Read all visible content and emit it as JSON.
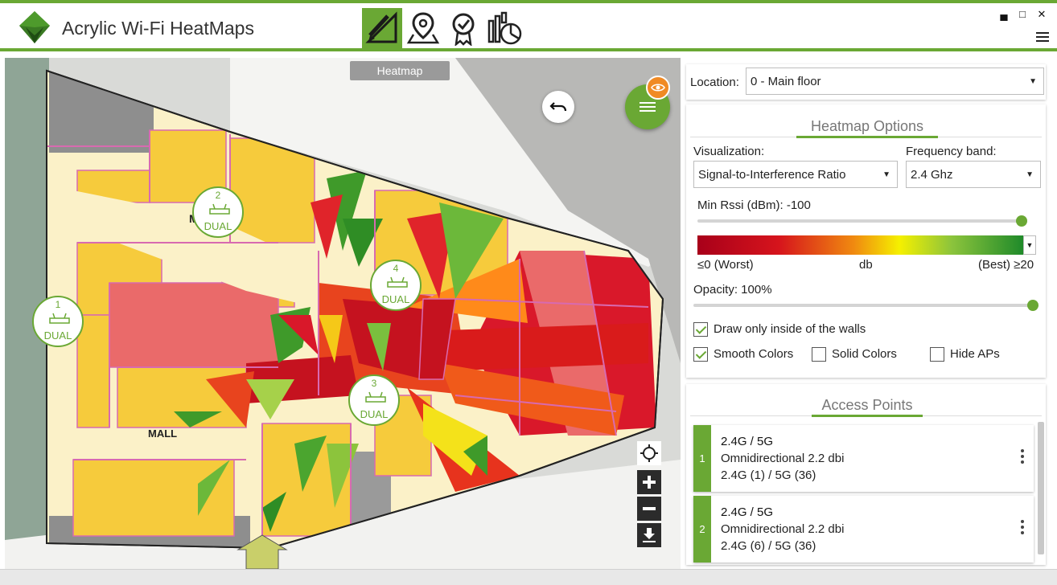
{
  "app": {
    "title": "Acrylic Wi-Fi HeatMaps",
    "accent_color": "#6aa834",
    "window_controls": [
      "minimize-icon",
      "maximize-icon",
      "close-icon"
    ],
    "toolbar": [
      "edit-plan-icon",
      "location-pin-icon",
      "certificate-icon",
      "reports-icon"
    ]
  },
  "map": {
    "tab_label": "Heatmap",
    "labels": [
      "MALL",
      "M"
    ],
    "access_points": [
      {
        "number": "1",
        "band": "DUAL"
      },
      {
        "number": "2",
        "band": "DUAL"
      },
      {
        "number": "3",
        "band": "DUAL"
      },
      {
        "number": "4",
        "band": "DUAL"
      }
    ]
  },
  "location": {
    "label": "Location:",
    "value": "0 - Main floor"
  },
  "heatmap_options": {
    "title": "Heatmap Options",
    "visualization_label": "Visualization:",
    "visualization_value": "Signal-to-Interference Ratio",
    "frequency_label": "Frequency band:",
    "frequency_value": "2.4 Ghz",
    "min_rssi_label": "Min Rssi (dBm): -100",
    "min_rssi_value": -100,
    "scale_min": "≤0 (Worst)",
    "scale_unit": "db",
    "scale_max": "(Best) ≥20",
    "opacity_label": "Opacity: 100%",
    "opacity_value": 100,
    "draw_inside_walls": "Draw only inside of the walls",
    "smooth_colors": "Smooth Colors",
    "solid_colors": "Solid Colors",
    "hide_aps": "Hide APs",
    "checks": {
      "draw_inside_walls": true,
      "smooth_colors": true,
      "solid_colors": false,
      "hide_aps": false
    }
  },
  "access_points_panel": {
    "title": "Access Points",
    "items": [
      {
        "index": "1",
        "name": "2.4G / 5G",
        "antenna": "Omnidirectional 2.2 dbi",
        "channels": "2.4G (1) / 5G (36)"
      },
      {
        "index": "2",
        "name": "2.4G / 5G",
        "antenna": "Omnidirectional 2.2 dbi",
        "channels": "2.4G (6) / 5G (36)"
      }
    ]
  }
}
